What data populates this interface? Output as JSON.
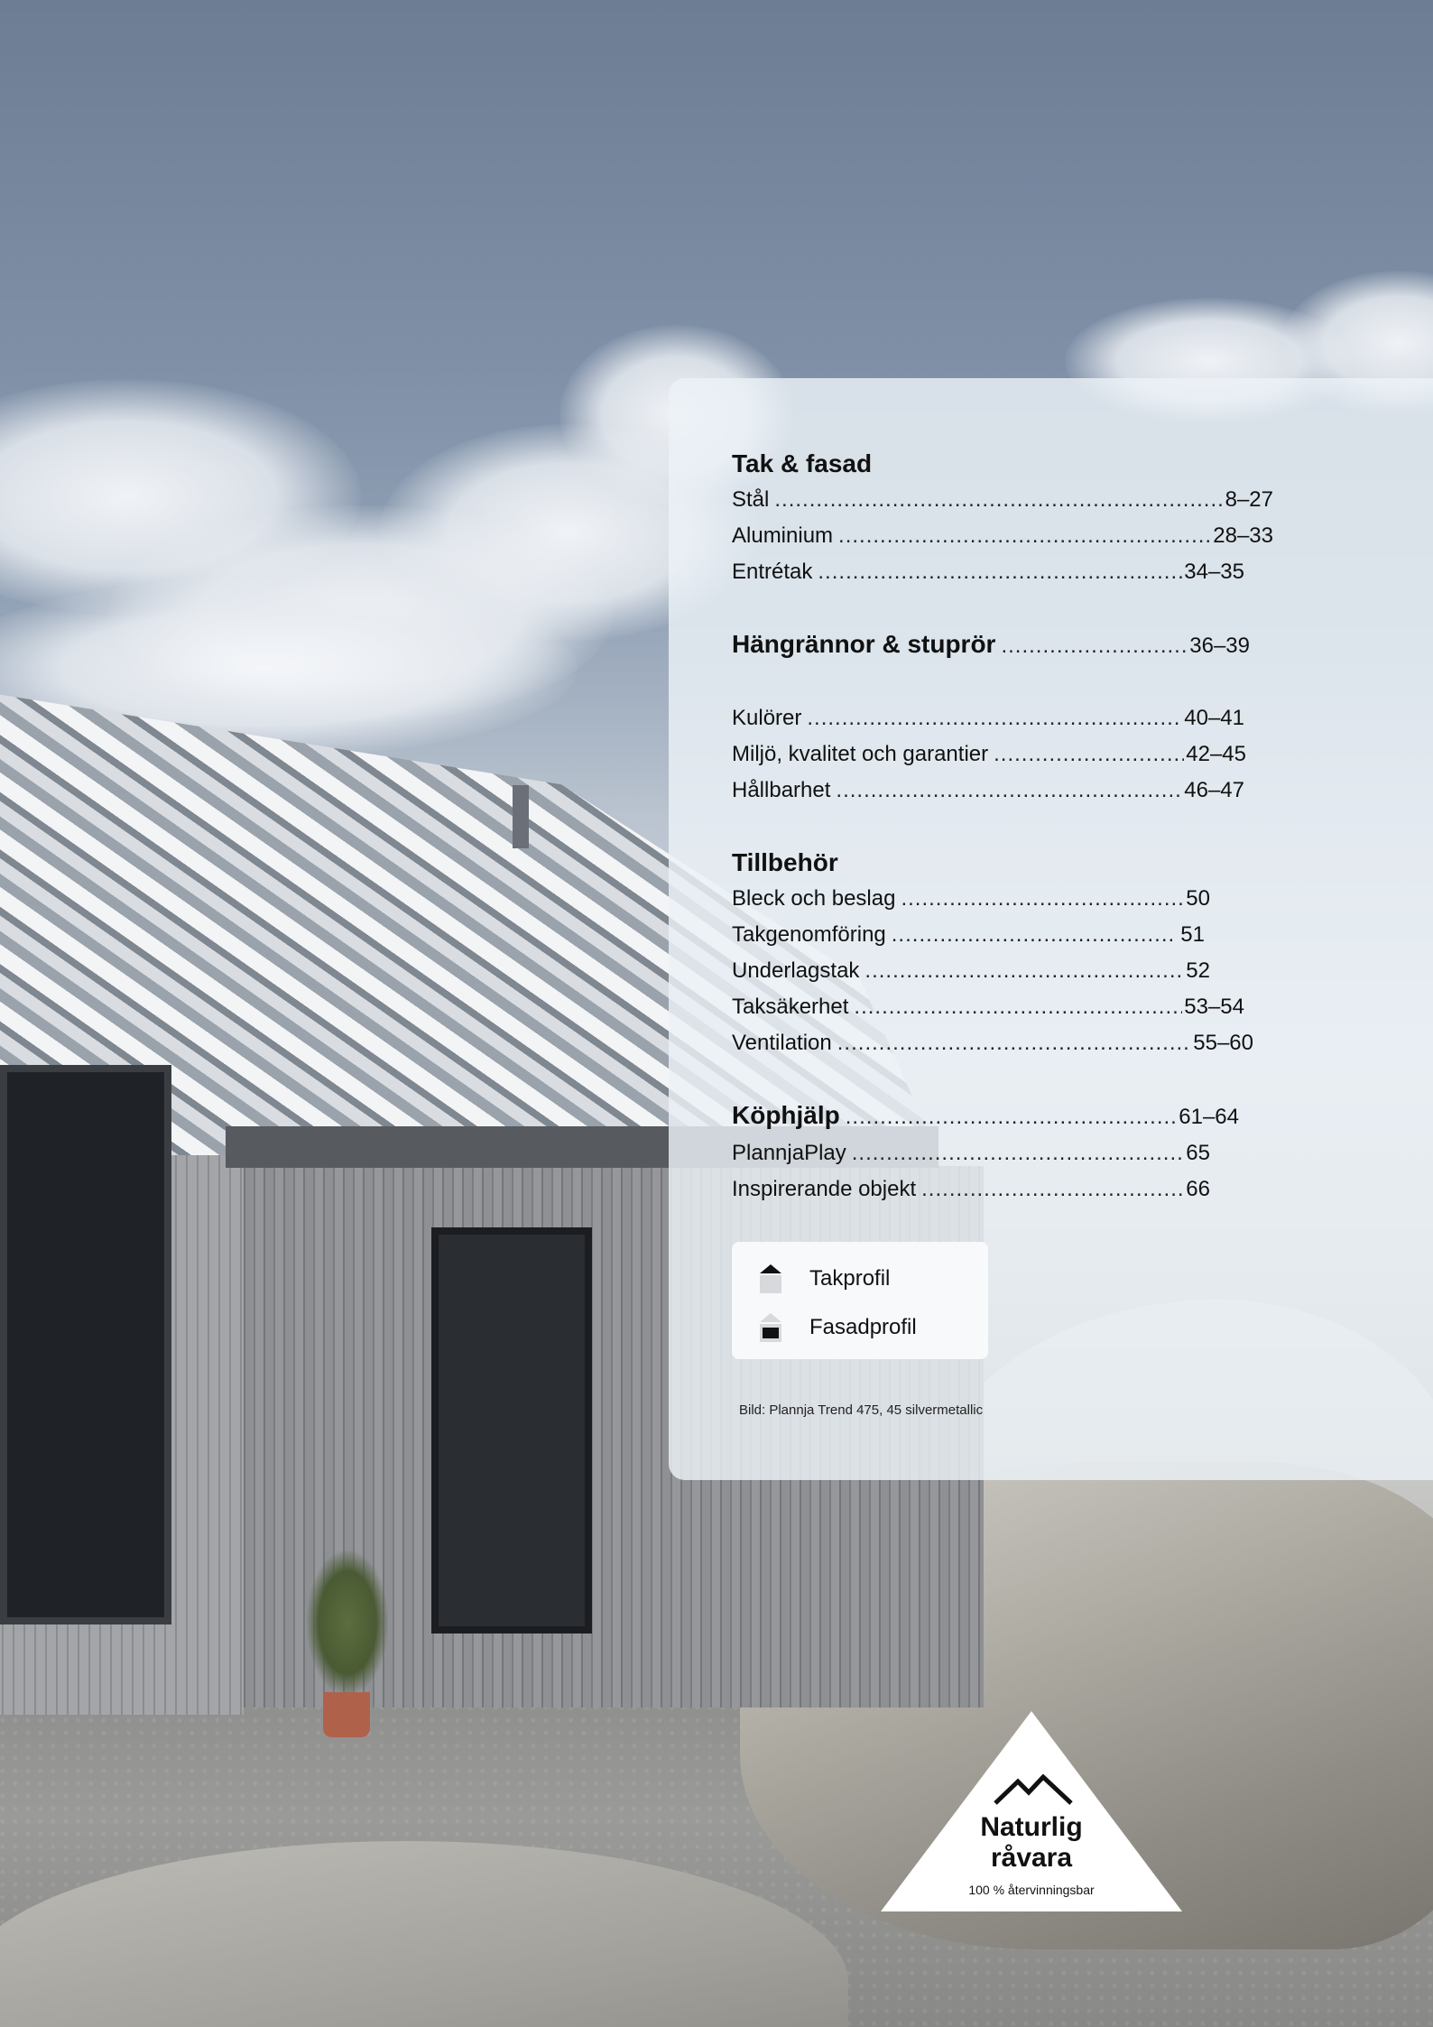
{
  "toc": {
    "section1": {
      "heading": "Tak & fasad",
      "items": [
        {
          "label": "Stål",
          "pages": "8–27"
        },
        {
          "label": "Aluminium",
          "pages": "28–33"
        },
        {
          "label": "Entrétak",
          "pages": "34–35"
        }
      ]
    },
    "section2": {
      "heading": "Hängrännor & stuprör",
      "pages": "36–39"
    },
    "section3": {
      "items": [
        {
          "label": "Kulörer",
          "pages": "40–41"
        },
        {
          "label": "Miljö, kvalitet och garantier",
          "pages": "42–45"
        },
        {
          "label": "Hållbarhet",
          "pages": "46–47"
        }
      ]
    },
    "section4": {
      "heading": "Tillbehör",
      "items": [
        {
          "label": "Bleck och beslag",
          "pages": "50"
        },
        {
          "label": "Takgenomföring",
          "pages": " 51"
        },
        {
          "label": "Underlagstak",
          "pages": "52"
        },
        {
          "label": "Taksäkerhet",
          "pages": "53–54"
        },
        {
          "label": "Ventilation",
          "pages": "55–60"
        }
      ]
    },
    "section5": {
      "heading": "Köphjälp",
      "pages": "61–64",
      "items": [
        {
          "label": "PlannjaPlay",
          "pages": "65"
        },
        {
          "label": "Inspirerande objekt",
          "pages": "66"
        }
      ]
    }
  },
  "legend": {
    "roof_profile": "Takprofil",
    "facade_profile": "Fasadprofil"
  },
  "caption": "Bild: Plannja Trend 475, 45 silvermetallic",
  "badge": {
    "line1": "Naturlig",
    "line2": "råvara",
    "sub": "100 % återvinningsbar",
    "icon": "mountain-icon"
  },
  "colors": {
    "panel": "#ECF1F7",
    "text": "#111111"
  }
}
